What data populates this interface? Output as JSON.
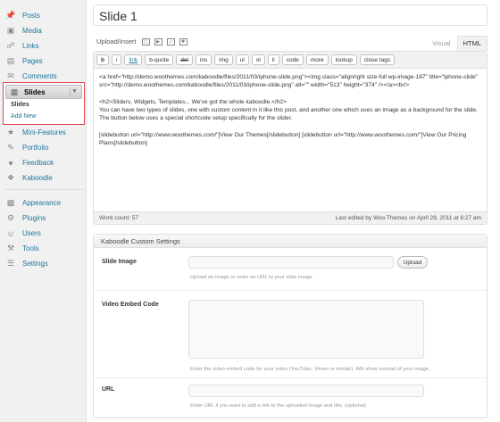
{
  "sidebar": {
    "items": [
      {
        "label": "Posts",
        "icon": "pushpin-icon"
      },
      {
        "label": "Media",
        "icon": "media-icon"
      },
      {
        "label": "Links",
        "icon": "link-icon"
      },
      {
        "label": "Pages",
        "icon": "pages-icon"
      },
      {
        "label": "Comments",
        "icon": "comments-icon"
      }
    ],
    "slides": {
      "label": "Slides",
      "icon": "slides-icon",
      "submenu": [
        "Slides",
        "Add New"
      ]
    },
    "items2": [
      {
        "label": "Mini-Features",
        "icon": "mini-features-icon"
      },
      {
        "label": "Portfolio",
        "icon": "portfolio-icon"
      },
      {
        "label": "Feedback",
        "icon": "feedback-icon"
      },
      {
        "label": "Kaboodle",
        "icon": "kaboodle-icon"
      }
    ],
    "items3": [
      {
        "label": "Appearance",
        "icon": "appearance-icon"
      },
      {
        "label": "Plugins",
        "icon": "plugins-icon"
      },
      {
        "label": "Users",
        "icon": "users-icon"
      },
      {
        "label": "Tools",
        "icon": "tools-icon"
      },
      {
        "label": "Settings",
        "icon": "settings-icon"
      }
    ]
  },
  "post": {
    "title": "Slide 1"
  },
  "editor": {
    "upload_label": "Upload/Insert",
    "tabs": [
      "Visual",
      "HTML"
    ],
    "buttons": [
      "b",
      "i",
      "link",
      "b-quote",
      "del",
      "ins",
      "img",
      "ul",
      "ol",
      "li",
      "code",
      "more",
      "lookup",
      "close tags"
    ],
    "content": [
      "<a href=\"http://demo.woothemes.com/kaboodle/files/2011/03/iphone-slide.png\"><img class=\"alignright size-full wp-image-187\" title=\"iphone-slide\" src=\"http://demo.woothemes.com/kaboodle/files/2011/03/iphone-slide.png\" alt=\"\" width=\"513\" height=\"374\" /></a><br/>",
      "<h2>Sliders, Widgets, Templates... We've got the whole kaboodle.</h2>\nYou can have two types of slides, one with custom content in it like this post, and another one which uses an image as a background for the slide.  The button below uses a special shortcode setup specifically for the slider.",
      "[slidebutton url=\"http://www.woothemes.com/\"]View Our Themes[/slidebutton] [slidebutton url=\"http://www.woothemes.com/\"]View Our Pricing Plans[/slidebutton]"
    ],
    "word_count": "Word count: 57",
    "last_edited": "Last edited by Woo Themes on April 28, 2011 at 6:27 am"
  },
  "meta": {
    "title": "Kaboodle Custom Settings",
    "slide_image": {
      "label": "Slide Image",
      "value": "",
      "button": "Upload",
      "help": "Upload an image or enter an URL to your slide image"
    },
    "video": {
      "label": "Video Embed Code",
      "value": "",
      "help": "Enter the video embed code for your video (YouTube, Vimeo or similar). Will show instead of your image."
    },
    "url": {
      "label": "URL",
      "value": "",
      "help": "Enter URL if you want to add a link to the uploaded image and title. (optional)"
    }
  }
}
